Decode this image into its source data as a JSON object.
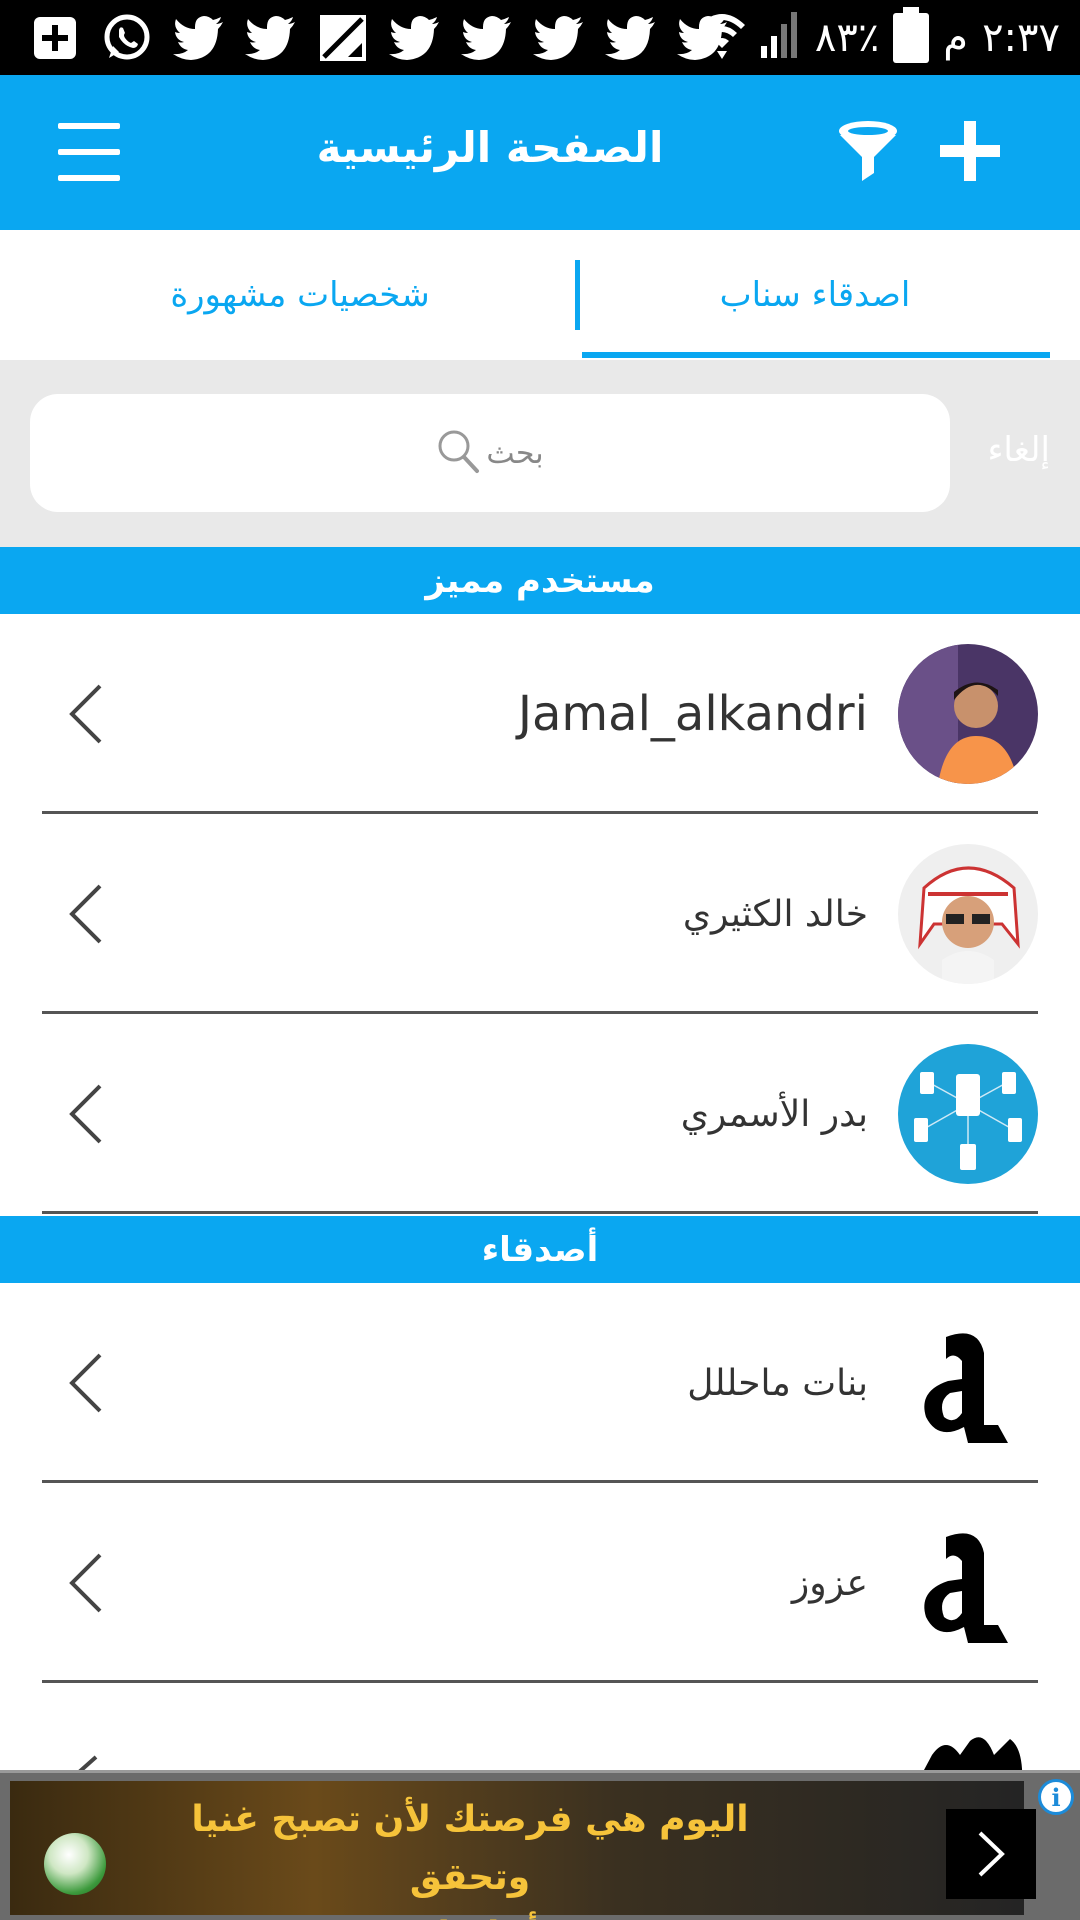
{
  "status_bar": {
    "time": "٢:٣٧",
    "ampm": "م",
    "battery": "٨٣٪",
    "icons": [
      "add-box-icon",
      "whatsapp-icon",
      "twitter-icon",
      "twitter-icon",
      "image-icon",
      "twitter-icon",
      "twitter-icon",
      "twitter-icon",
      "twitter-icon",
      "wifi-icon",
      "signal-icon",
      "battery-icon"
    ]
  },
  "app_bar": {
    "title": "الصفحة الرئيسية",
    "icons": [
      "menu-icon",
      "filter-icon",
      "plus-icon"
    ]
  },
  "tabs": [
    {
      "label": "اصدقاء سناب",
      "active": true
    },
    {
      "label": "شخصيات مشهورة",
      "active": false
    }
  ],
  "search": {
    "placeholder": "بحث",
    "cancel_label": "إلغاء"
  },
  "sections": {
    "premium": {
      "title": "مستخدم مميز",
      "items": [
        {
          "name": "Jamal_alkandri"
        },
        {
          "name": "خالد الكثيري"
        },
        {
          "name": "بدر الأسمري"
        }
      ]
    },
    "friends": {
      "title": "أصدقاء",
      "items": [
        {
          "name": "بنات ماحللل"
        },
        {
          "name": "عزوز"
        }
      ]
    }
  },
  "ad": {
    "text_line1": "اليوم هي فرصتك لأن تصبح غنيا وتحقق",
    "text_line2": "أحلامك!",
    "info_label": "i"
  },
  "colors": {
    "primary": "#0aa7f1",
    "ad_text": "#f6c33a"
  }
}
